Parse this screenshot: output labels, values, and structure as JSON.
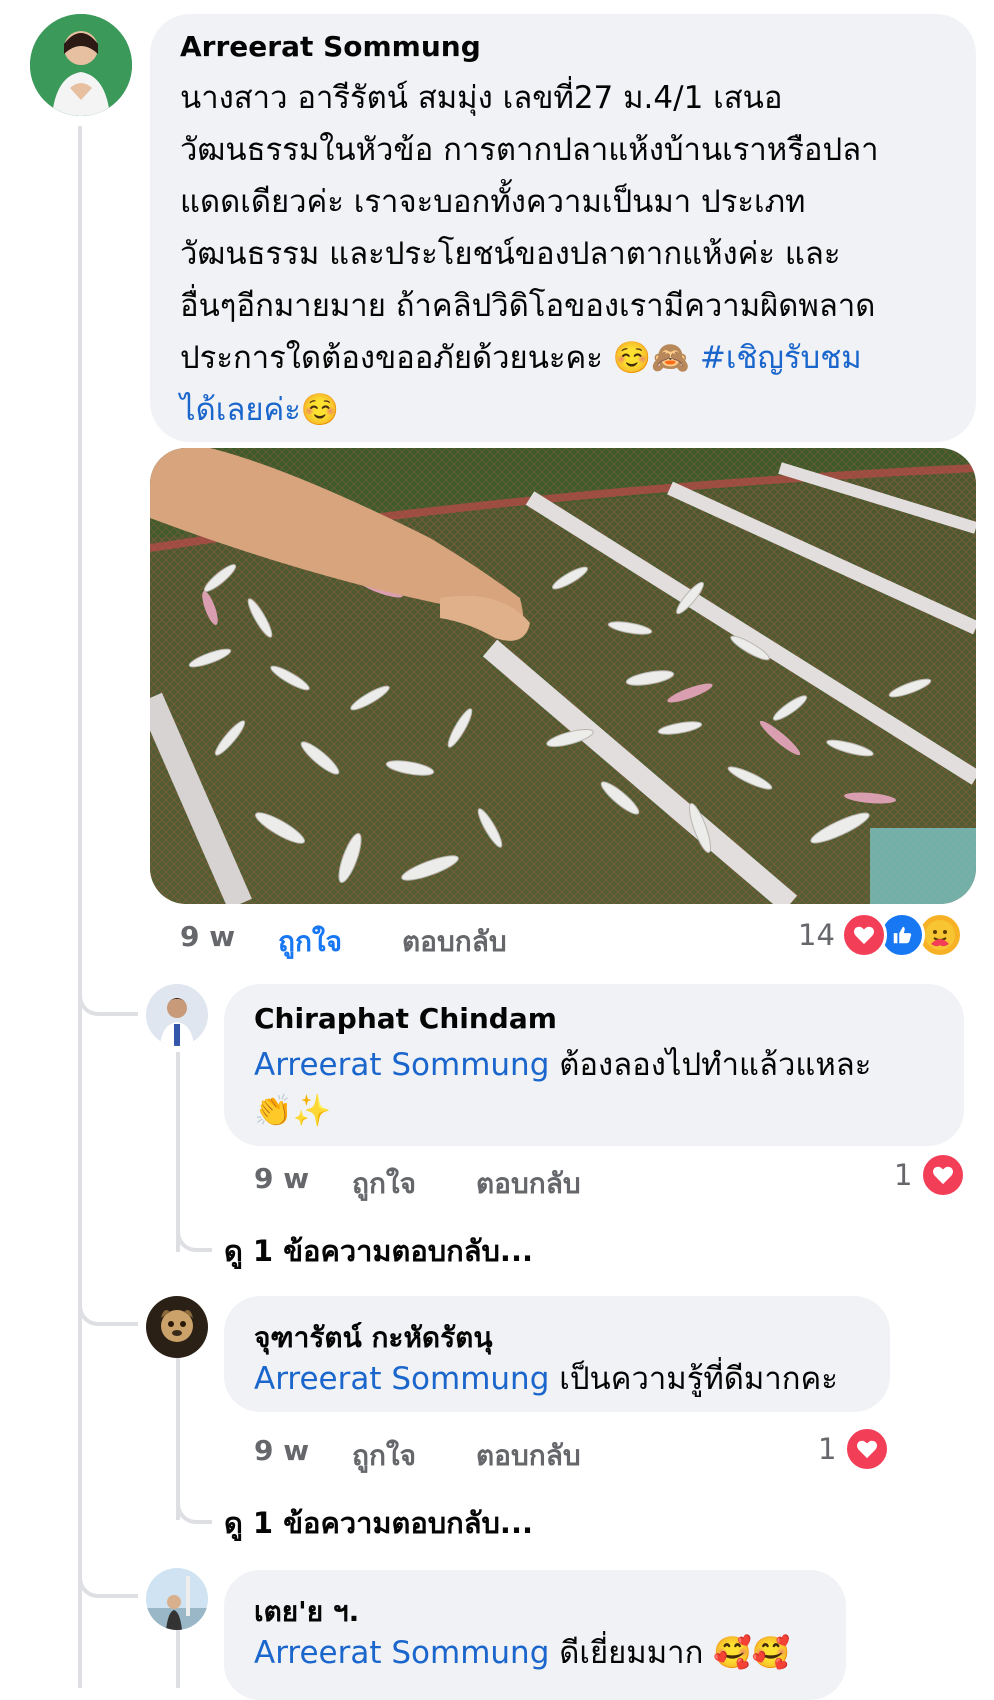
{
  "post": {
    "author": "Arreerat Sommung",
    "text_lines": [
      "นางสาว อารีรัตน์ สมมุ่ง เลขที่27 ม.4/1 เสนอ",
      "วัฒนธรรมในหัวข้อ การตากปลาแห้งบ้านเราหรือปลา",
      "แดดเดียวค่ะ เราจะบอกทั้งความเป็นมา ประเภท",
      "วัฒนธรรม และประโยชน์ของปลาตากแห้งค่ะ และ",
      "อื่นๆอีกมายมาย ถ้าคลิปวิดิโอของเรามีความผิดพลาด"
    ],
    "text_line6": "ประการใดต้องขออภัยด้วยนะคะ ☺️🙈",
    "hashtag": "#เชิญรับชม",
    "text_line7": "ได้เลยค่ะ☺️",
    "time": "9 w",
    "like_label": "ถูกใจ",
    "reply_label": "ตอบกลับ",
    "reaction_count": "14"
  },
  "comments": [
    {
      "author": "Chiraphat Chindam",
      "mention": "Arreerat Sommung",
      "text": " ต้องลองไปทำแล้วแหละ",
      "text_line2": "👏✨",
      "time": "9 w",
      "like_label": "ถูกใจ",
      "reply_label": "ตอบกลับ",
      "reaction_count": "1",
      "view_replies": "ดู 1 ข้อความตอบกลับ..."
    },
    {
      "author": "จุฑารัตน์ กะหัดรัตนุ",
      "mention": "Arreerat Sommung",
      "text": " เป็นความรู้ที่ดีมากคะ",
      "time": "9 w",
      "like_label": "ถูกใจ",
      "reply_label": "ตอบกลับ",
      "reaction_count": "1",
      "view_replies": "ดู 1 ข้อความตอบกลับ..."
    },
    {
      "author": "เตย'ย ฯ.",
      "mention": "Arreerat Sommung",
      "text": " ดีเยี่ยมมาก 🥰🥰"
    }
  ],
  "icons": {
    "love": "love-reaction-icon",
    "like": "like-reaction-icon",
    "care": "care-reaction-icon"
  },
  "colors": {
    "bubble": "#f0f2f5",
    "link": "#1a66cc",
    "like_active": "#1877f2",
    "love": "#f33e58",
    "like": "#1877f2",
    "care": "#f7b125"
  }
}
